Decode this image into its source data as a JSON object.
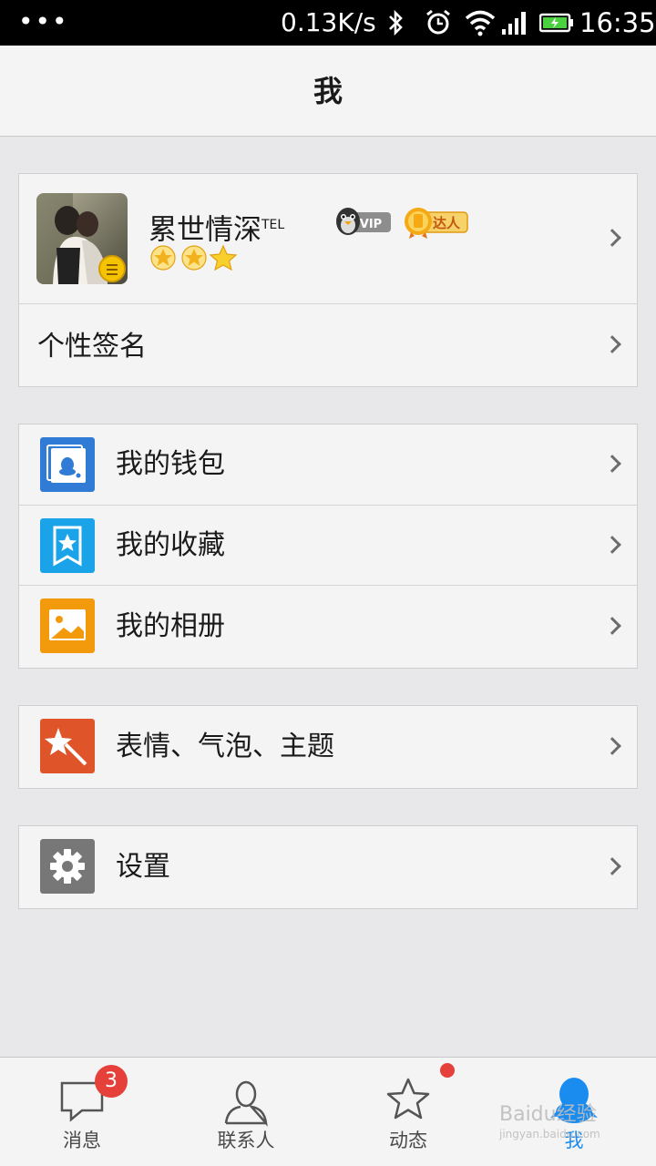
{
  "status_bar": {
    "dots": "•••",
    "net_speed": "0.13K/s",
    "time": "16:35",
    "icons": [
      "bluetooth-icon",
      "alarm-icon",
      "wifi-icon",
      "signal-icon",
      "battery-icon"
    ]
  },
  "header": {
    "title": "我"
  },
  "profile": {
    "nickname": "累世情深",
    "nickname_suffix": "TEL",
    "vip_label": "VIP",
    "daren_label": "达人",
    "level_icons": [
      "sun-icon",
      "sun-icon",
      "star-icon"
    ]
  },
  "signature": {
    "label": "个性签名"
  },
  "menu_group_1": [
    {
      "label": "我的钱包",
      "icon": "wallet-icon",
      "color": "#2f7bd6"
    },
    {
      "label": "我的收藏",
      "icon": "favorites-icon",
      "color": "#1aa3e8"
    },
    {
      "label": "我的相册",
      "icon": "album-icon",
      "color": "#f29a0c"
    }
  ],
  "menu_group_2": [
    {
      "label": "表情、气泡、主题",
      "icon": "magic-wand-icon",
      "color": "#e0542a"
    }
  ],
  "menu_group_3": [
    {
      "label": "设置",
      "icon": "gear-icon",
      "color": "#777777"
    }
  ],
  "bottom_nav": [
    {
      "label": "消息",
      "icon": "chat-bubble-icon",
      "badge": "3"
    },
    {
      "label": "联系人",
      "icon": "contact-icon"
    },
    {
      "label": "动态",
      "icon": "star-outline-icon",
      "has_dot": true
    },
    {
      "label": "我",
      "icon": "qq-penguin-icon",
      "active": true
    }
  ],
  "colors": {
    "accent": "#1a8cf0",
    "badge": "#e5403a",
    "background": "#e8e8ea"
  },
  "watermark": {
    "text": "Baidu经验",
    "sub": "jingyan.baidu.com"
  }
}
